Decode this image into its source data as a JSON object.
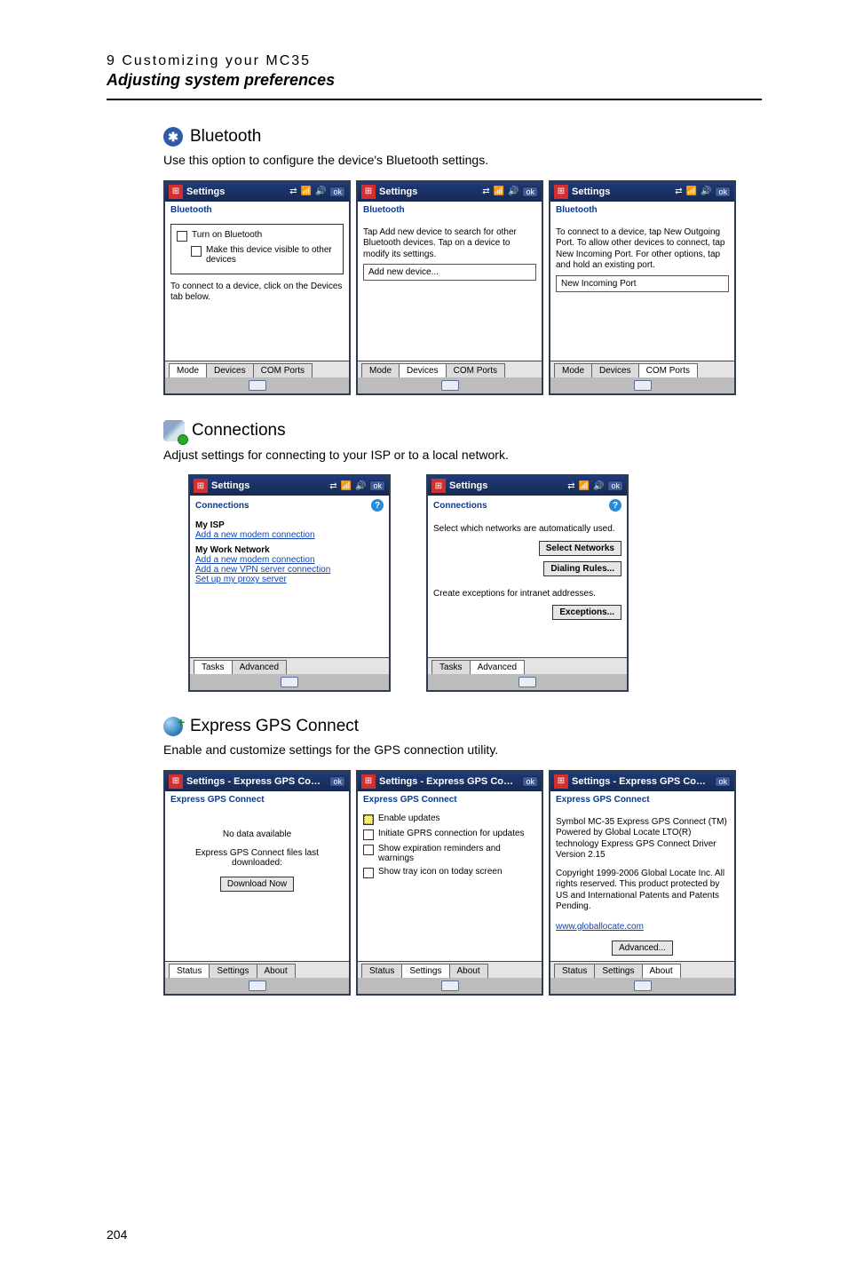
{
  "header": {
    "chapter": "9 Customizing your MC35",
    "section_title": "Adjusting system preferences"
  },
  "page_number": "204",
  "bluetooth": {
    "title": "Bluetooth",
    "desc": "Use this option to configure the device's Bluetooth settings.",
    "s1": {
      "titlebar": "Settings",
      "subhead": "Bluetooth",
      "opt1": "Turn on Bluetooth",
      "opt2": "Make this device visible to other devices",
      "note": "To connect to a device, click on the Devices tab below.",
      "tabs": [
        "Mode",
        "Devices",
        "COM Ports"
      ]
    },
    "s2": {
      "titlebar": "Settings",
      "subhead": "Bluetooth",
      "text": "Tap Add new device to search for other Bluetooth devices. Tap on a device to modify its settings.",
      "item": "Add new device...",
      "tabs": [
        "Mode",
        "Devices",
        "COM Ports"
      ]
    },
    "s3": {
      "titlebar": "Settings",
      "subhead": "Bluetooth",
      "text": "To connect to a device, tap New Outgoing Port. To allow other devices to connect, tap New Incoming Port. For other options, tap and hold an existing port.",
      "item": "New Incoming Port",
      "tabs": [
        "Mode",
        "Devices",
        "COM Ports"
      ]
    }
  },
  "connections": {
    "title": "Connections",
    "desc": "Adjust settings for connecting to your ISP or to a local network.",
    "s1": {
      "titlebar": "Settings",
      "subhead": "Connections",
      "g1_title": "My ISP",
      "g1_link": "Add a new modem connection",
      "g2_title": "My Work Network",
      "g2_link1": "Add a new modem connection",
      "g2_link2": "Add a new VPN server connection",
      "g2_link3": "Set up my proxy server",
      "tabs": [
        "Tasks",
        "Advanced"
      ]
    },
    "s2": {
      "titlebar": "Settings",
      "subhead": "Connections",
      "line1": "Select which networks are automatically used.",
      "btn1": "Select Networks",
      "btn2": "Dialing Rules...",
      "line2": "Create exceptions for intranet addresses.",
      "btn3": "Exceptions...",
      "tabs": [
        "Tasks",
        "Advanced"
      ]
    }
  },
  "gps": {
    "title": "Express GPS Connect",
    "desc": "Enable and customize settings for the GPS connection utility.",
    "s1": {
      "titlebar": "Settings - Express GPS Connect",
      "subhead": "Express GPS Connect",
      "line1": "No data available",
      "line2": "Express GPS Connect files last downloaded:",
      "btn": "Download Now",
      "tabs": [
        "Status",
        "Settings",
        "About"
      ]
    },
    "s2": {
      "titlebar": "Settings - Express GPS Connect",
      "subhead": "Express GPS Connect",
      "c1": "Enable updates",
      "c2": "Initiate GPRS connection for updates",
      "c3": "Show expiration reminders and warnings",
      "c4": "Show tray icon on today screen",
      "tabs": [
        "Status",
        "Settings",
        "About"
      ]
    },
    "s3": {
      "titlebar": "Settings - Express GPS Connect",
      "subhead": "Express GPS Connect",
      "p1": "Symbol MC-35 Express GPS Connect (TM) Powered by Global Locate LTO(R) technology Express GPS Connect Driver Version 2.15",
      "p2": "Copyright 1999-2006 Global Locate Inc. All rights reserved.  This product protected by US and International Patents and Patents Pending.",
      "link": "www.globallocate.com",
      "btn": "Advanced...",
      "tabs": [
        "Status",
        "Settings",
        "About"
      ]
    }
  },
  "tray": {
    "sig": "⇄",
    "ant": "📶",
    "vol": "🔊",
    "ok": "ok"
  }
}
